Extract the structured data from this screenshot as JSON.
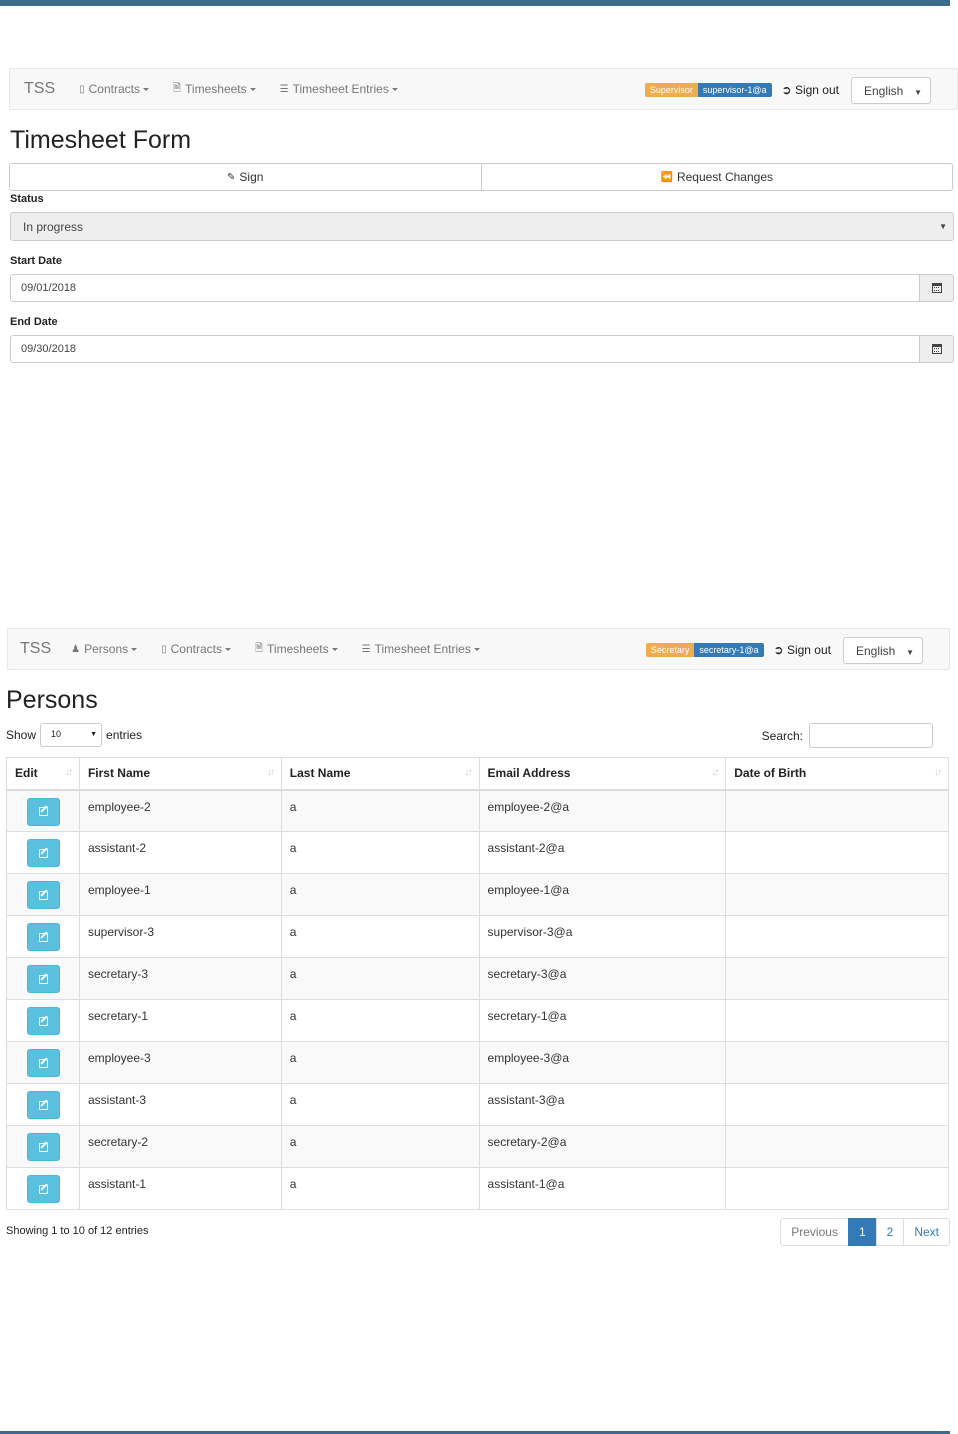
{
  "top": {
    "navbar": {
      "brand": "TSS",
      "items": [
        {
          "label": "Contracts",
          "icon": "book-icon"
        },
        {
          "label": "Timesheets",
          "icon": "document-icon"
        },
        {
          "label": "Timesheet Entries",
          "icon": "list-icon"
        }
      ],
      "role": "Supervisor",
      "user": "supervisor-1@a",
      "signout": "Sign out",
      "language": "English"
    },
    "title": "Timesheet Form",
    "buttons": {
      "sign": "Sign",
      "request_changes": "Request Changes"
    },
    "status": {
      "label": "Status",
      "value": "In progress"
    },
    "start_date": {
      "label": "Start Date",
      "value": "09/01/2018"
    },
    "end_date": {
      "label": "End Date",
      "value": "09/30/2018"
    }
  },
  "bottom": {
    "navbar": {
      "brand": "TSS",
      "items": [
        {
          "label": "Persons",
          "icon": "user-icon"
        },
        {
          "label": "Contracts",
          "icon": "book-icon"
        },
        {
          "label": "Timesheets",
          "icon": "document-icon"
        },
        {
          "label": "Timesheet Entries",
          "icon": "list-icon"
        }
      ],
      "role": "Secretary",
      "user": "secretary-1@a",
      "signout": "Sign out",
      "language": "English"
    },
    "title": "Persons",
    "show_label": "Show",
    "page_length": "10",
    "entries_label": "entries",
    "search_label": "Search:",
    "columns": [
      "Edit",
      "First Name",
      "Last Name",
      "Email Address",
      "Date of Birth"
    ],
    "rows": [
      {
        "first": "employee-2",
        "last": "a",
        "email": "employee-2@a",
        "dob": ""
      },
      {
        "first": "assistant-2",
        "last": "a",
        "email": "assistant-2@a",
        "dob": ""
      },
      {
        "first": "employee-1",
        "last": "a",
        "email": "employee-1@a",
        "dob": ""
      },
      {
        "first": "supervisor-3",
        "last": "a",
        "email": "supervisor-3@a",
        "dob": ""
      },
      {
        "first": "secretary-3",
        "last": "a",
        "email": "secretary-3@a",
        "dob": ""
      },
      {
        "first": "secretary-1",
        "last": "a",
        "email": "secretary-1@a",
        "dob": ""
      },
      {
        "first": "employee-3",
        "last": "a",
        "email": "employee-3@a",
        "dob": ""
      },
      {
        "first": "assistant-3",
        "last": "a",
        "email": "assistant-3@a",
        "dob": ""
      },
      {
        "first": "secretary-2",
        "last": "a",
        "email": "secretary-2@a",
        "dob": ""
      },
      {
        "first": "assistant-1",
        "last": "a",
        "email": "assistant-1@a",
        "dob": ""
      }
    ],
    "info": "Showing 1 to 10 of 12 entries",
    "pagination": {
      "previous": "Previous",
      "pages": [
        "1",
        "2"
      ],
      "active": "1",
      "next": "Next"
    }
  }
}
